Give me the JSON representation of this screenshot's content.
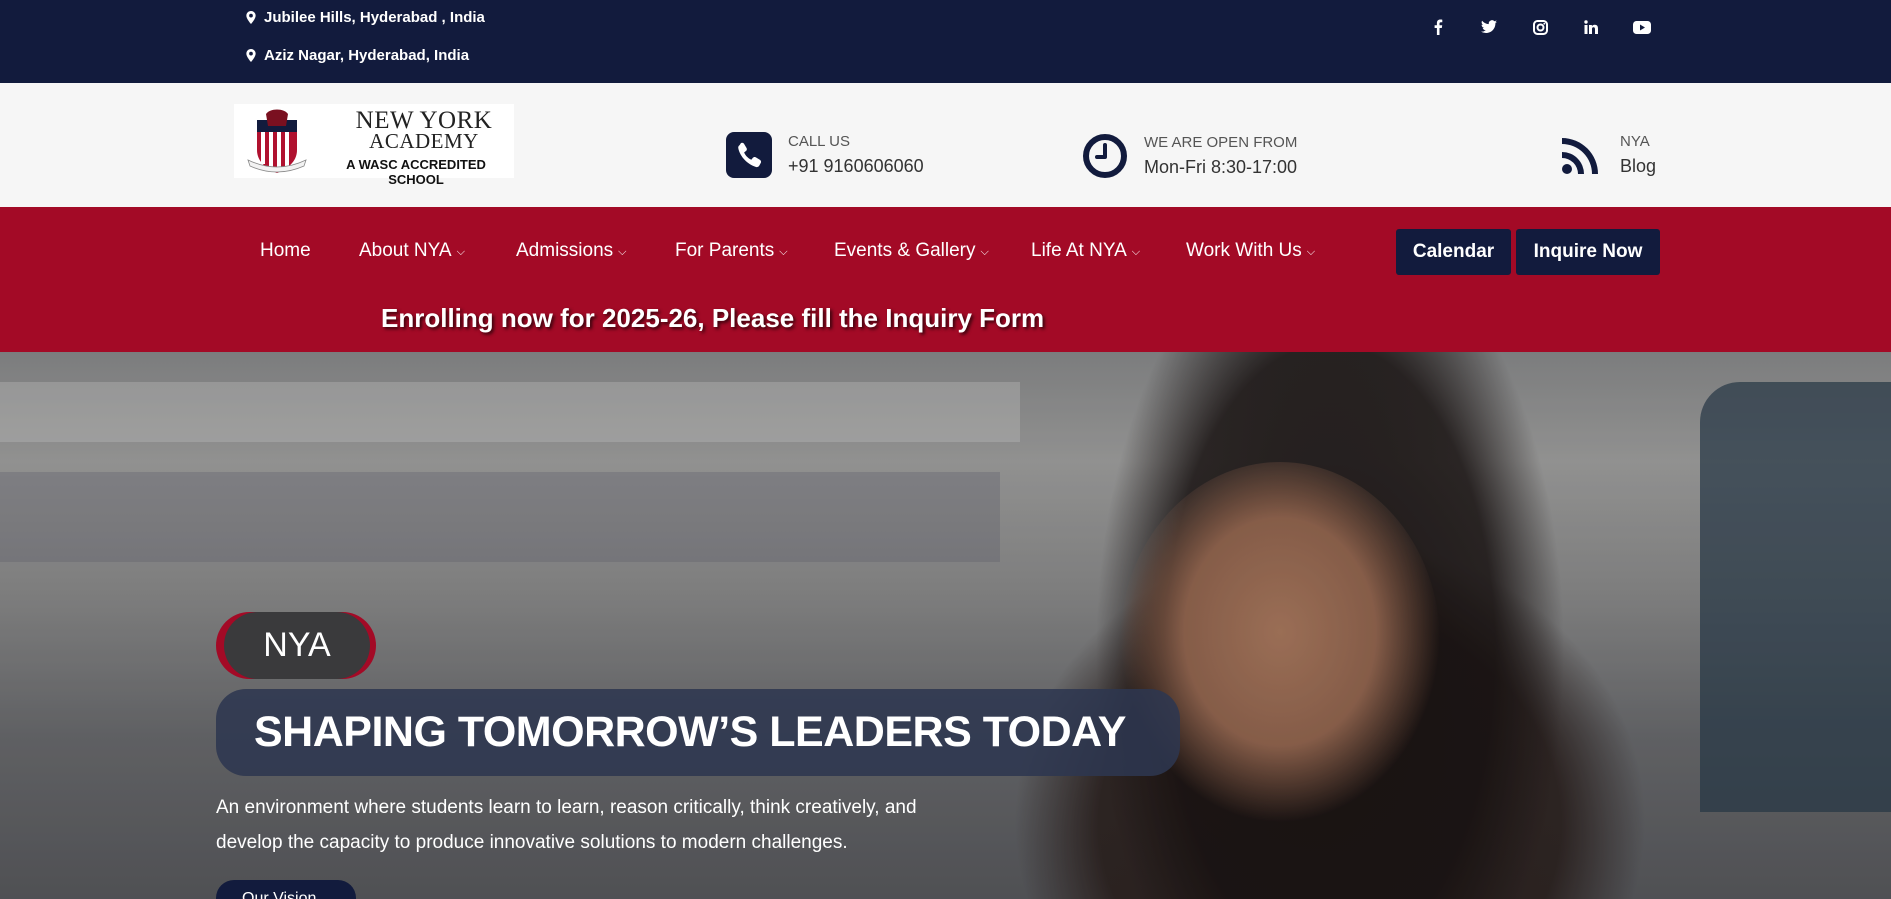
{
  "topbar": {
    "addresses": [
      "Jubilee Hills, Hyderabad , India",
      "Aziz Nagar, Hyderabad, India"
    ],
    "social": [
      "facebook-icon",
      "twitter-icon",
      "instagram-icon",
      "linkedin-icon",
      "youtube-icon"
    ]
  },
  "logo": {
    "line1": "NEW YORK",
    "line2": "ACADEMY",
    "line3": "A WASC ACCREDITED SCHOOL"
  },
  "header": {
    "call_label": "CALL US",
    "call_value": "+91 9160606060",
    "open_label": "WE ARE OPEN FROM",
    "open_value": "Mon-Fri 8:30-17:00",
    "blog_label": "NYA",
    "blog_value": "Blog"
  },
  "nav": {
    "items": [
      {
        "label": "Home"
      },
      {
        "label": "About NYA"
      },
      {
        "label": "Admissions"
      },
      {
        "label": "For Parents"
      },
      {
        "label": "Events & Gallery"
      },
      {
        "label": "Life At NYA"
      },
      {
        "label": "Work With Us"
      }
    ],
    "calendar": "Calendar",
    "inquire": "Inquire Now",
    "banner": "Enrolling now for 2025-26, Please fill the Inquiry Form"
  },
  "hero": {
    "badge": "NYA",
    "headline": "SHAPING TOMORROW’S LEADERS TODAY",
    "description": "An environment where students learn to learn, reason critically, think creatively, and develop the capacity to produce innovative solutions to modern challenges.",
    "cta": "Our Vision"
  },
  "colors": {
    "navy": "#121b3d",
    "crimson": "#a30a26",
    "header_bg": "#f6f6f6"
  }
}
